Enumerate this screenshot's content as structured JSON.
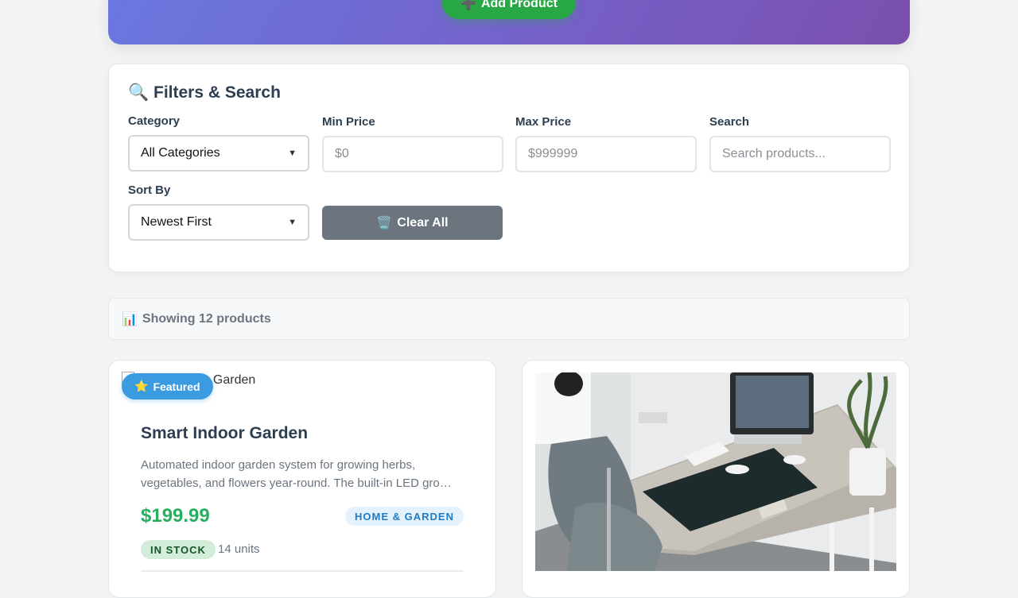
{
  "header": {
    "add_product_label": "Add Product",
    "add_icon": "plus-icon"
  },
  "filters": {
    "title": "Filters & Search",
    "title_icon": "magnifier-icon",
    "category": {
      "label": "Category",
      "selected": "All Categories"
    },
    "min_price": {
      "label": "Min Price",
      "placeholder": "$0"
    },
    "max_price": {
      "label": "Max Price",
      "placeholder": "$999999"
    },
    "search": {
      "label": "Search",
      "placeholder": "Search products..."
    },
    "sort": {
      "label": "Sort By",
      "selected": "Newest First"
    },
    "clear_label": "Clear All",
    "clear_icon": "trash-icon"
  },
  "results": {
    "text": "Showing 12 products",
    "icon": "bar-chart-icon"
  },
  "products": [
    {
      "image_alt": "Smart Indoor Garden",
      "badge": "Featured",
      "badge_icon": "star-icon",
      "name": "Smart Indoor Garden",
      "description": "Automated indoor garden system for growing herbs, vegetables, and flowers year-round. The built-in LED gro…",
      "price": "$199.99",
      "category": "HOME & GARDEN",
      "stock_status": "IN STOCK",
      "units": "14 units"
    },
    {
      "image_subject": "office-desk-photo"
    }
  ],
  "colors": {
    "accent_green": "#28a745",
    "price_green": "#27ae60",
    "header_gradient_start": "#6a78e0",
    "header_gradient_end": "#7a4fae",
    "featured_blue": "#3b9be0",
    "clear_gray": "#6c757d"
  }
}
